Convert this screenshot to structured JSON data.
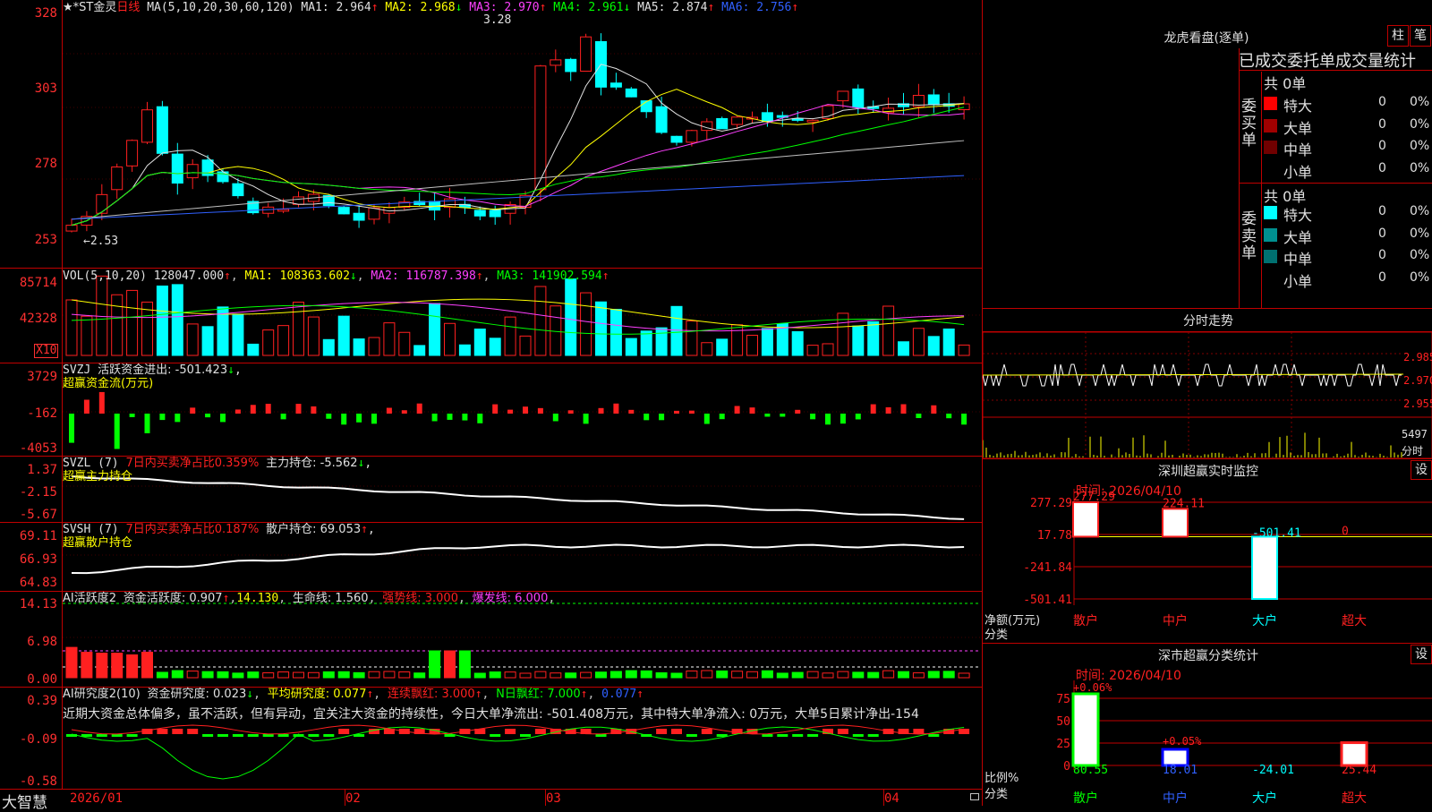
{
  "stock": {
    "name": "★*ST金灵",
    "period": "日线"
  },
  "kline": {
    "ma_header": "MA(5,10,20,30,60,120)",
    "ma": [
      {
        "label": "MA1: 2.964",
        "arrow": "↑",
        "color": "#e0e0e0"
      },
      {
        "label": "MA2: 2.968",
        "arrow": "↓",
        "color": "#ffff00"
      },
      {
        "label": "MA3: 2.970",
        "arrow": "↑",
        "color": "#ff40ff"
      },
      {
        "label": "MA4: 2.961",
        "arrow": "↓",
        "color": "#00ff00"
      },
      {
        "label": "MA5: 2.874",
        "arrow": "↑",
        "color": "#e0e0e0"
      },
      {
        "label": "MA6: 2.756",
        "arrow": "↑",
        "color": "#3060ff"
      }
    ],
    "y_labels": [
      "328",
      "303",
      "278",
      "253"
    ],
    "high_mark": "3.28",
    "low_mark": "←2.53"
  },
  "vol": {
    "header": "VOL(5,10,20)",
    "value": "128047.000",
    "value_arrow": "↑",
    "ma1": "MA1: 108363.602",
    "ma1_arrow": "↓",
    "ma2": "MA2: 116787.398",
    "ma2_arrow": "↑",
    "ma3": "MA3: 141902.594",
    "ma3_arrow": "↑",
    "y_labels": [
      "85714",
      "42328"
    ],
    "unit": "X10"
  },
  "svzj": {
    "header": "SVZJ",
    "text": "活跃资金进出: -501.423",
    "arrow": "↓",
    "tail": ",",
    "sub": "超赢资金流(万元)",
    "y_labels": [
      "3729",
      "-162",
      "-4053"
    ]
  },
  "svzl": {
    "header": "SVZL (7)",
    "ratio": "7日内买卖净占比0.359%",
    "holding": "主力持仓: -5.562",
    "arrow": "↓",
    "tail": ",",
    "sub": "超赢主力持仓",
    "y_labels": [
      "1.37",
      "-2.15",
      "-5.67"
    ]
  },
  "svsh": {
    "header": "SVSH (7)",
    "ratio": "7日内买卖净占比0.187%",
    "holding": "散户持仓: 69.053",
    "arrow": "↑",
    "tail": ",",
    "sub": "超赢散户持仓",
    "y_labels": [
      "69.11",
      "66.93",
      "64.83"
    ]
  },
  "ai_active": {
    "header": "AI活跃度2",
    "text": "资金活跃度: 0.907",
    "a1": "↑",
    "v2": "14.130",
    "life": "生命线: 1.560",
    "strong": "强势线: 3.000",
    "burst": "爆发线: 6.000",
    "y_labels": [
      "14.13",
      "6.98",
      "0.00"
    ]
  },
  "ai_research": {
    "header": "AI研究度2(10)",
    "text": "资金研究度: 0.023",
    "a1": "↓",
    "avg": "平均研究度: 0.077",
    "a2": "↑",
    "cont": "连续飘红: 3.000",
    "a3": "↑",
    "n": "N日飘红: 7.000",
    "a4": "↑",
    "last": "0.077",
    "a5": "↑",
    "comment": "近期大资金总体偏多，虽不活跃，但有异动，宜关注大资金的持续性，今日大单净流出: -501.408万元，其中特大单净流入: 0万元，大单5日累计净出-154",
    "y_labels": [
      "0.39",
      "-0.09",
      "-0.58"
    ]
  },
  "x_axis": {
    "labels": [
      "2026/01",
      "02",
      "03",
      "04"
    ],
    "brand": "大智慧"
  },
  "dragon": {
    "title": "龙虎看盘(逐单)",
    "btn_bar": "柱",
    "btn_pen": "笔",
    "tabs": "已成交委托单成交量统计",
    "buy": {
      "side": "委买单",
      "total": "共 0单",
      "rows": [
        {
          "name": "特大",
          "v1": "0",
          "v2": "0%",
          "color": "#ff0000"
        },
        {
          "name": "大单",
          "v1": "0",
          "v2": "0%",
          "color": "#a00000"
        },
        {
          "name": "中单",
          "v1": "0",
          "v2": "0%",
          "color": "#700000"
        },
        {
          "name": "小单",
          "v1": "0",
          "v2": "0%",
          "color": ""
        }
      ]
    },
    "sell": {
      "side": "委卖单",
      "total": "共 0单",
      "rows": [
        {
          "name": "特大",
          "v1": "0",
          "v2": "0%",
          "color": "#00ffff"
        },
        {
          "name": "大单",
          "v1": "0",
          "v2": "0%",
          "color": "#009090"
        },
        {
          "name": "中单",
          "v1": "0",
          "v2": "0%",
          "color": "#007070"
        },
        {
          "name": "小单",
          "v1": "0",
          "v2": "0%",
          "color": ""
        }
      ]
    }
  },
  "intraday": {
    "title": "分时走势",
    "y_labels": [
      "2.985",
      "2.970",
      "2.955"
    ],
    "vol_label": "5497",
    "vol_unit": "分时"
  },
  "sz_monitor": {
    "title": "深圳超赢实时监控",
    "settings": "设",
    "time": "时间: 2026/04/10",
    "y_labels": [
      "277.29",
      "17.78",
      "-241.84",
      "-501.41"
    ],
    "axis_title": "净额(万元)",
    "cat_title": "分类",
    "categories": [
      "散户",
      "中户",
      "大户",
      "超大"
    ],
    "values": [
      277.29,
      224.11,
      -501.41,
      0
    ],
    "value_labels": [
      "277.29",
      "224.11",
      "-501.41",
      "0"
    ]
  },
  "sz_classify": {
    "title": "深市超赢分类统计",
    "settings": "设",
    "time": "时间: 2026/04/10",
    "y_labels": [
      "75",
      "50",
      "25",
      "0"
    ],
    "axis_title": "比例%",
    "cat_title": "分类",
    "categories": [
      "散户",
      "中户",
      "大户",
      "超大"
    ],
    "values": [
      80.55,
      18.01,
      -24.01,
      25.44
    ],
    "value_labels": [
      "80.55",
      "18.01",
      "-24.01",
      "25.44"
    ],
    "change_labels": [
      "+0.06%",
      "+0.05%"
    ]
  },
  "colors": {
    "up": "#ff2020",
    "down": "#00ffff",
    "grid": "#c00000",
    "bg": "#000000"
  }
}
